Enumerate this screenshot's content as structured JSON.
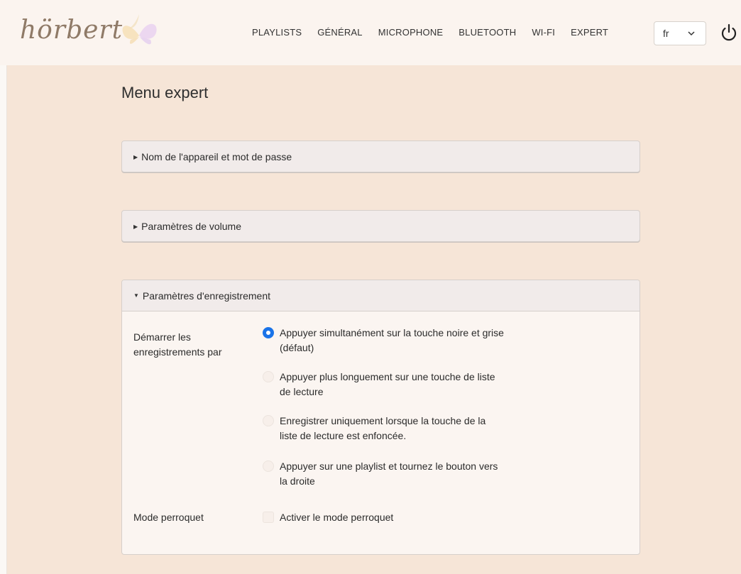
{
  "header": {
    "logo_text": "hörbert",
    "nav": [
      "PLAYLISTS",
      "GÉNÉRAL",
      "MICROPHONE",
      "BLUETOOTH",
      "WI-FI",
      "EXPERT"
    ],
    "language": "fr"
  },
  "page": {
    "title": "Menu expert"
  },
  "panels": {
    "device": {
      "title": "Nom de l'appareil et mot de passe",
      "expanded": false
    },
    "volume": {
      "title": "Paramètres de volume",
      "expanded": false
    },
    "recording": {
      "title": "Paramètres d'enregistrement",
      "expanded": true,
      "start_label": "Démarrer les enregistrements par",
      "options": [
        "Appuyer simultanément sur la touche noire et grise (défaut)",
        "Appuyer plus longuement sur une touche de liste de lecture",
        "Enregistrer uniquement lorsque la touche de la liste de lecture est enfoncée.",
        "Appuyer sur une playlist et tournez le bouton vers la droite"
      ],
      "selected_option": 0,
      "parrot_label": "Mode perroquet",
      "parrot_checkbox_label": "Activer le mode perroquet",
      "parrot_checked": false
    }
  },
  "colors": {
    "accent": "#1a73e8",
    "page_background": "#f6e5d7",
    "header_background": "#fbf4ef"
  }
}
